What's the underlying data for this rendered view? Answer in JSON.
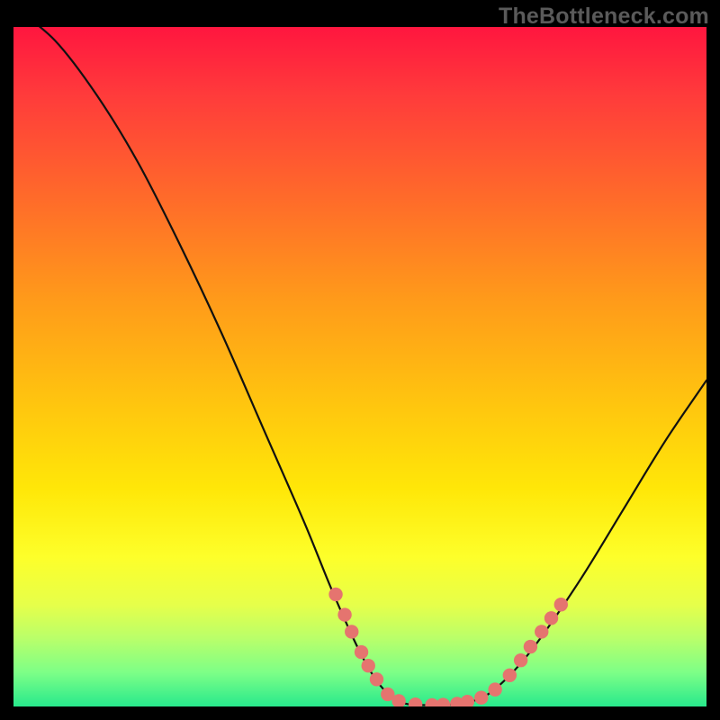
{
  "watermark": "TheBottleneck.com",
  "colors": {
    "curve": "#111111",
    "dots": "#e5746f",
    "background_frame": "#000000"
  },
  "chart_data": {
    "type": "line",
    "title": "",
    "xlabel": "",
    "ylabel": "",
    "xlim": [
      0,
      100
    ],
    "ylim": [
      0,
      100
    ],
    "curve": [
      {
        "x": 0,
        "y": 103
      },
      {
        "x": 6,
        "y": 98
      },
      {
        "x": 12,
        "y": 90
      },
      {
        "x": 18,
        "y": 80
      },
      {
        "x": 24,
        "y": 68
      },
      {
        "x": 30,
        "y": 55
      },
      {
        "x": 36,
        "y": 41
      },
      {
        "x": 42,
        "y": 27
      },
      {
        "x": 46,
        "y": 17
      },
      {
        "x": 50,
        "y": 8
      },
      {
        "x": 53,
        "y": 3
      },
      {
        "x": 56,
        "y": 0.6
      },
      {
        "x": 60,
        "y": 0.2
      },
      {
        "x": 64,
        "y": 0.4
      },
      {
        "x": 68,
        "y": 1.5
      },
      {
        "x": 72,
        "y": 5
      },
      {
        "x": 76,
        "y": 10
      },
      {
        "x": 82,
        "y": 19
      },
      {
        "x": 88,
        "y": 29
      },
      {
        "x": 94,
        "y": 39
      },
      {
        "x": 100,
        "y": 48
      }
    ],
    "highlight_dots": [
      {
        "x": 46.5,
        "y": 16.5
      },
      {
        "x": 47.8,
        "y": 13.5
      },
      {
        "x": 48.8,
        "y": 11.0
      },
      {
        "x": 50.2,
        "y": 8.0
      },
      {
        "x": 51.2,
        "y": 6.0
      },
      {
        "x": 52.4,
        "y": 4.0
      },
      {
        "x": 54.0,
        "y": 1.8
      },
      {
        "x": 55.6,
        "y": 0.8
      },
      {
        "x": 58.0,
        "y": 0.3
      },
      {
        "x": 60.4,
        "y": 0.2
      },
      {
        "x": 62.0,
        "y": 0.25
      },
      {
        "x": 64.0,
        "y": 0.4
      },
      {
        "x": 65.5,
        "y": 0.7
      },
      {
        "x": 67.5,
        "y": 1.3
      },
      {
        "x": 69.5,
        "y": 2.5
      },
      {
        "x": 71.6,
        "y": 4.6
      },
      {
        "x": 73.2,
        "y": 6.8
      },
      {
        "x": 74.6,
        "y": 8.8
      },
      {
        "x": 76.2,
        "y": 11.0
      },
      {
        "x": 77.6,
        "y": 13.0
      },
      {
        "x": 79.0,
        "y": 15.0
      }
    ],
    "dot_radius_pct": 1.0
  }
}
